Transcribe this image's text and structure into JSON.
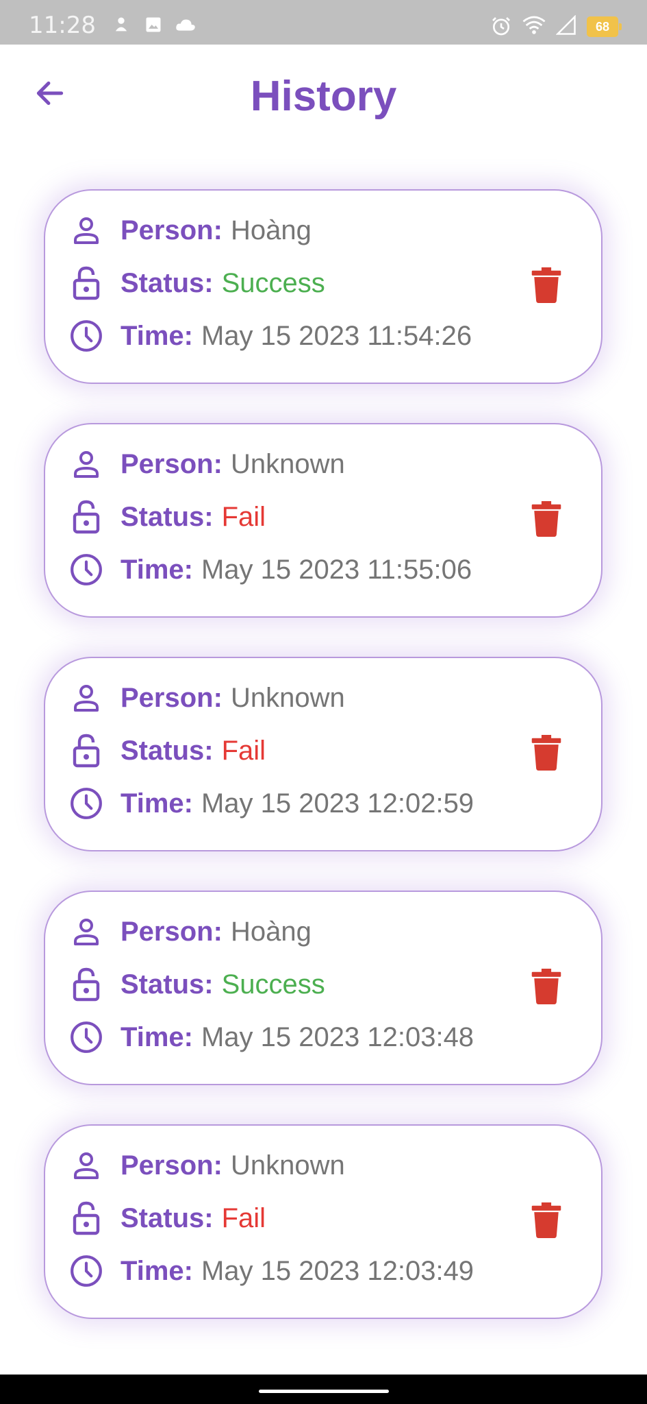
{
  "status_bar": {
    "time": "11:28",
    "battery": "68",
    "icons": [
      "notification-icon",
      "gallery-icon",
      "cloud-icon",
      "alarm-icon",
      "wifi-icon",
      "signal-icon",
      "battery-icon"
    ]
  },
  "app_bar": {
    "title": "History",
    "back_icon": "arrow-left-icon"
  },
  "labels": {
    "person": "Person:",
    "status": "Status:",
    "time": "Time:"
  },
  "colors": {
    "accent": "#7b4fbd",
    "success": "#4caf50",
    "fail": "#e53935",
    "delete": "#d63b2f"
  },
  "history": [
    {
      "person": "Hoàng",
      "status": "Success",
      "time": "May 15 2023 11:54:26"
    },
    {
      "person": "Unknown",
      "status": "Fail",
      "time": "May 15 2023 11:55:06"
    },
    {
      "person": "Unknown",
      "status": "Fail",
      "time": "May 15 2023 12:02:59"
    },
    {
      "person": "Hoàng",
      "status": "Success",
      "time": "May 15 2023 12:03:48"
    },
    {
      "person": "Unknown",
      "status": "Fail",
      "time": "May 15 2023 12:03:49"
    }
  ]
}
